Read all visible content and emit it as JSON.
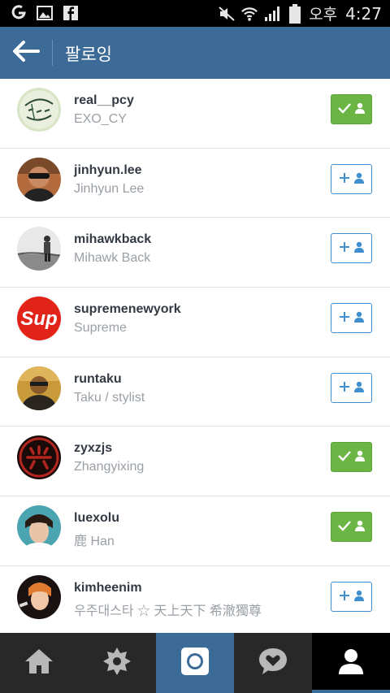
{
  "status_bar": {
    "carrier": "오후",
    "time": "4:27",
    "icons": [
      "notification-app-icon",
      "image-icon",
      "facebook-icon",
      "mute-icon",
      "wifi-icon",
      "signal-icon",
      "battery-icon"
    ]
  },
  "header": {
    "title": "팔로잉",
    "back_icon": "back-arrow-icon"
  },
  "colors": {
    "action_bar": "#3d6b98",
    "following_button": "#6bb544",
    "follow_button_border": "#3f8fd0",
    "bottom_nav": "#282828"
  },
  "users": [
    {
      "username": "real__pcy",
      "fullname": "EXO_CY",
      "following": true
    },
    {
      "username": "jinhyun.lee",
      "fullname": "Jinhyun Lee",
      "following": false
    },
    {
      "username": "mihawkback",
      "fullname": "Mihawk Back",
      "following": false
    },
    {
      "username": "supremenewyork",
      "fullname": "Supreme",
      "following": false
    },
    {
      "username": "runtaku",
      "fullname": "Taku / stylist",
      "following": false
    },
    {
      "username": "zyxzjs",
      "fullname": "Zhangyixing",
      "following": true
    },
    {
      "username": "luexolu",
      "fullname": "鹿 Han",
      "following": true
    },
    {
      "username": "kimheenim",
      "fullname": "우주대스타 ☆ 天上天下 希澈獨尊",
      "following": false
    }
  ],
  "avatar_texts": {
    "real__pcy": "Happiness Deliver",
    "supremenewyork": "Sup"
  },
  "bottom_nav": [
    "home-icon",
    "explore-icon",
    "camera-icon",
    "activity-icon",
    "profile-icon"
  ]
}
